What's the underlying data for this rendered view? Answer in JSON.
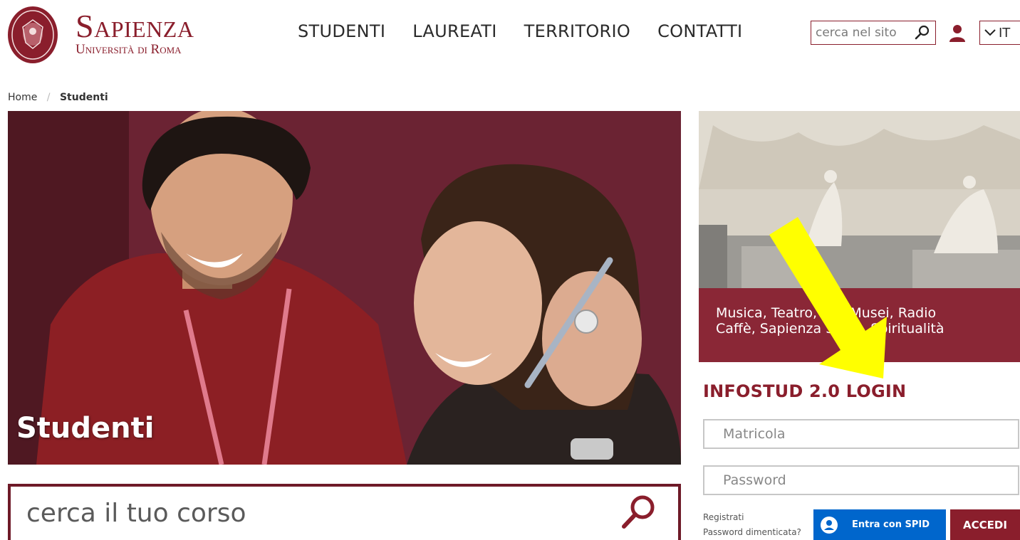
{
  "header": {
    "logo_name": "Sapienza",
    "logo_sub": "Università di Roma",
    "nav": [
      "STUDENTI",
      "LAUREATI",
      "TERRITORIO",
      "CONTATTI"
    ],
    "search_placeholder": "cerca nel sito",
    "language": "IT"
  },
  "breadcrumb": {
    "home": "Home",
    "separator": "/",
    "current": "Studenti"
  },
  "hero": {
    "title": "Studenti"
  },
  "course_search": {
    "placeholder": "cerca il tuo corso"
  },
  "promo": {
    "line1": "Musica, Teatro, Art, Musei, Radio",
    "line2": "Caffè, Sapienza Sport, Spiritualità"
  },
  "login": {
    "title": "INFOSTUD 2.0 LOGIN",
    "matricola_placeholder": "Matricola",
    "password_placeholder": "Password",
    "register": "Registrati",
    "forgot": "Password dimenticata?",
    "spid_label": "Entra con SPID",
    "submit": "ACCEDI"
  },
  "colors": {
    "brand": "#8a1e2c",
    "spid": "#0066cc",
    "annotation_arrow": "#ffff00"
  }
}
